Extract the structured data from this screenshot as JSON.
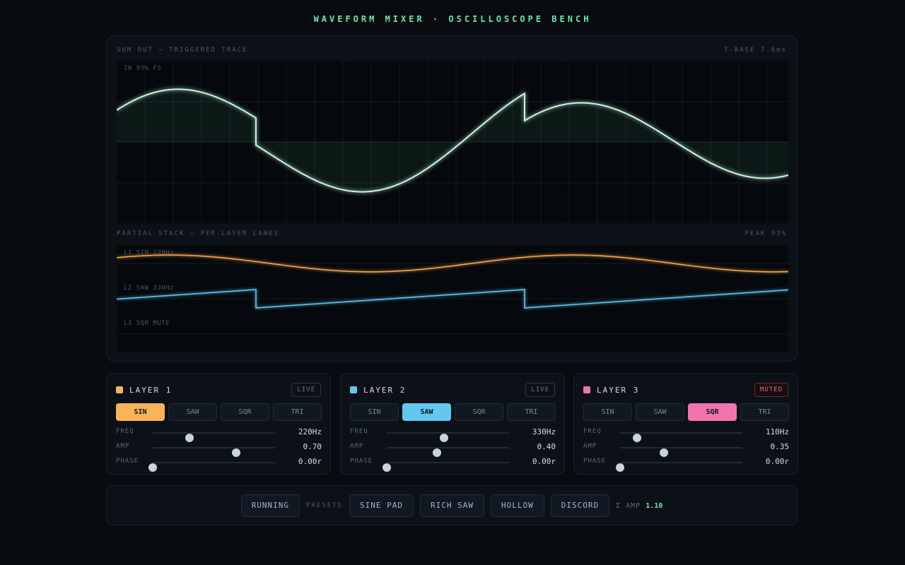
{
  "app": {
    "title": "WAVEFORM MIXER · OSCILLOSCOPE BENCH"
  },
  "scope": {
    "label": "SUM OUT — TRIGGERED TRACE",
    "timebase": "T-BASE 7.6ms",
    "level_label": "IN 93% FS",
    "trace_color": "#c9f5df"
  },
  "stack": {
    "label": "PARTIAL STACK — PER-LAYER LANES",
    "peak": "PEAK 93%",
    "lanes": [
      {
        "label": "L1 SIN 220Hz",
        "color": "#f5a54a"
      },
      {
        "label": "L2 SAW 330Hz",
        "color": "#5cc5ef"
      },
      {
        "label": "L3 SQR MUTE",
        "color": "#f06fa6"
      }
    ]
  },
  "layers": [
    {
      "name": "LAYER 1",
      "color": "#f8b456",
      "status": "LIVE",
      "muted": false,
      "waves": [
        "SIN",
        "SAW",
        "SQR",
        "TRI"
      ],
      "active_wave": "SIN",
      "params": [
        {
          "label": "FREQ",
          "value": "220Hz",
          "level": 0.3
        },
        {
          "label": "AMP",
          "value": "0.70",
          "level": 0.68
        },
        {
          "label": "PHASE",
          "value": "0.00r",
          "level": 0.0
        }
      ]
    },
    {
      "name": "LAYER 2",
      "color": "#62c8f2",
      "status": "LIVE",
      "muted": false,
      "waves": [
        "SIN",
        "SAW",
        "SQR",
        "TRI"
      ],
      "active_wave": "SAW",
      "params": [
        {
          "label": "FREQ",
          "value": "330Hz",
          "level": 0.47
        },
        {
          "label": "AMP",
          "value": "0.40",
          "level": 0.41
        },
        {
          "label": "PHASE",
          "value": "0.00r",
          "level": 0.0
        }
      ]
    },
    {
      "name": "LAYER 3",
      "color": "#f374ad",
      "status": "MUTED",
      "muted": true,
      "waves": [
        "SIN",
        "SAW",
        "SQR",
        "TRI"
      ],
      "active_wave": "SQR",
      "params": [
        {
          "label": "FREQ",
          "value": "110Hz",
          "level": 0.14
        },
        {
          "label": "AMP",
          "value": "0.35",
          "level": 0.36
        },
        {
          "label": "PHASE",
          "value": "0.00r",
          "level": 0.0
        }
      ]
    }
  ],
  "transport": {
    "run_label": "RUNNING",
    "presets_label": "PRESETS",
    "presets": [
      "SINE PAD",
      "RICH SAW",
      "HOLLOW",
      "DISCORD"
    ],
    "sum_label": "Σ AMP",
    "sum_value": "1.10"
  },
  "colors": {
    "accent": "#6fe7a6",
    "background": "#080b10",
    "panel": "#0c1117"
  }
}
